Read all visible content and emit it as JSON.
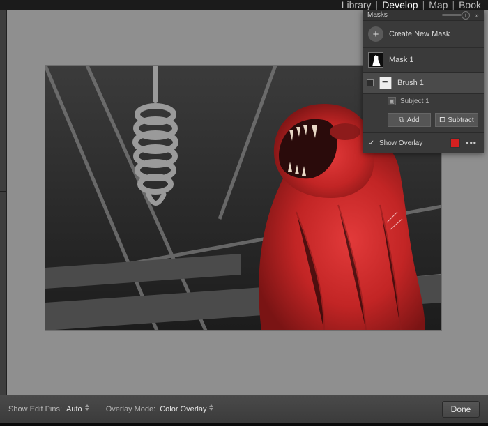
{
  "top_tabs": {
    "library": "Library",
    "develop": "Develop",
    "map": "Map",
    "book": "Book"
  },
  "masks_panel": {
    "title": "Masks",
    "create_label": "Create New Mask",
    "mask1_label": "Mask 1",
    "brush1_label": "Brush 1",
    "subject1_label": "Subject 1",
    "add_label": "Add",
    "subtract_label": "Subtract",
    "show_overlay_label": "Show Overlay",
    "overlay_checked": true,
    "overlay_color": "#d42020"
  },
  "bottom_bar": {
    "edit_pins_label": "Show Edit Pins:",
    "edit_pins_value": "Auto",
    "overlay_mode_label": "Overlay Mode:",
    "overlay_mode_value": "Color Overlay",
    "done_label": "Done"
  }
}
